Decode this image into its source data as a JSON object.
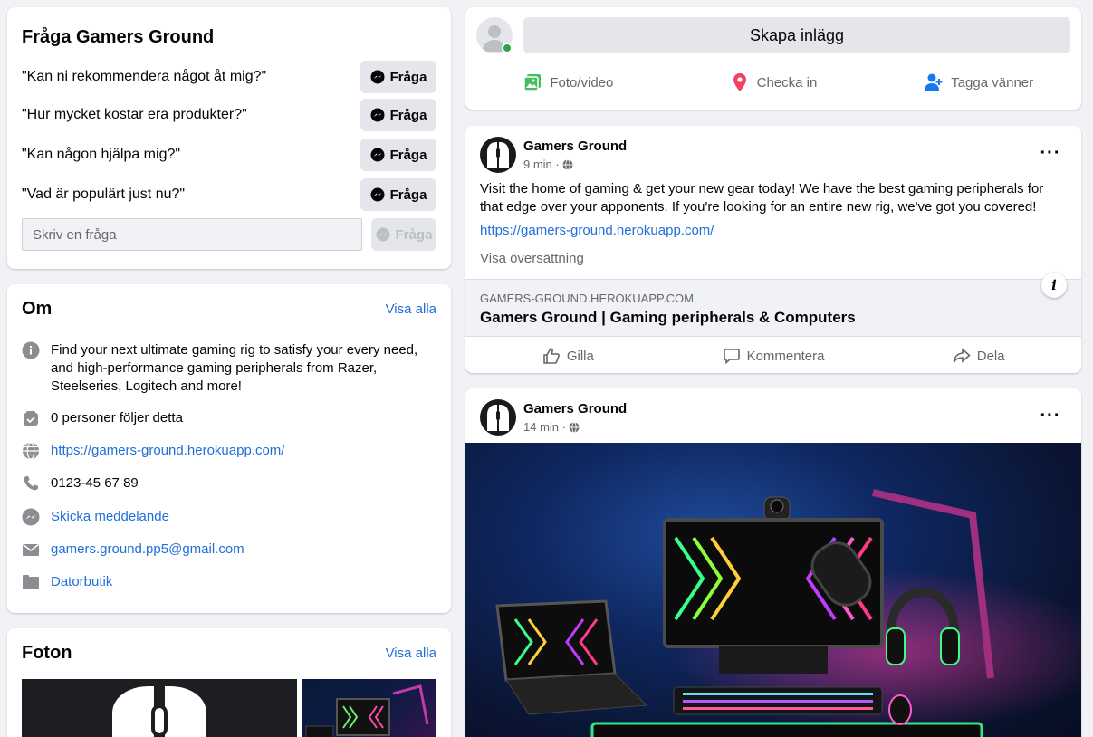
{
  "ask": {
    "title": "Fråga Gamers Ground",
    "questions": [
      "\"Kan ni rekommendera något åt mig?\"",
      "\"Hur mycket kostar era produkter?\"",
      "\"Kan någon hjälpa mig?\"",
      "\"Vad är populärt just nu?\""
    ],
    "button_label": "Fråga",
    "input_placeholder": "Skriv en fråga",
    "submit_label": "Fråga"
  },
  "about": {
    "title": "Om",
    "see_all": "Visa alla",
    "description": "Find your next ultimate gaming rig to satisfy your every need, and high-performance gaming peripherals from Razer, Steelseries, Logitech and more!",
    "followers": "0 personer följer detta",
    "website": "https://gamers-ground.herokuapp.com/",
    "phone": "0123-45 67 89",
    "message": "Skicka meddelande",
    "email": "gamers.ground.pp5@gmail.com",
    "category": "Datorbutik"
  },
  "photos": {
    "title": "Foton",
    "see_all": "Visa alla"
  },
  "create_post": {
    "button": "Skapa inlägg",
    "actions": [
      "Foto/video",
      "Checka in",
      "Tagga vänner"
    ],
    "action_colors": [
      "#45bd62",
      "#f3425f",
      "#1877f2"
    ]
  },
  "post1": {
    "author": "Gamers Ground",
    "time": "9 min ·",
    "text": "Visit the home of gaming & get your new gear today! We have the best gaming peripherals for that edge over your apponents. If you're looking for an entire new rig, we've got you covered!",
    "link": "https://gamers-ground.herokuapp.com/",
    "translate": "Visa översättning",
    "preview_domain": "GAMERS-GROUND.HEROKUAPP.COM",
    "preview_title": "Gamers Ground | Gaming peripherals & Computers",
    "actions": [
      "Gilla",
      "Kommentera",
      "Dela"
    ]
  },
  "post2": {
    "author": "Gamers Ground",
    "time": "14 min ·"
  }
}
